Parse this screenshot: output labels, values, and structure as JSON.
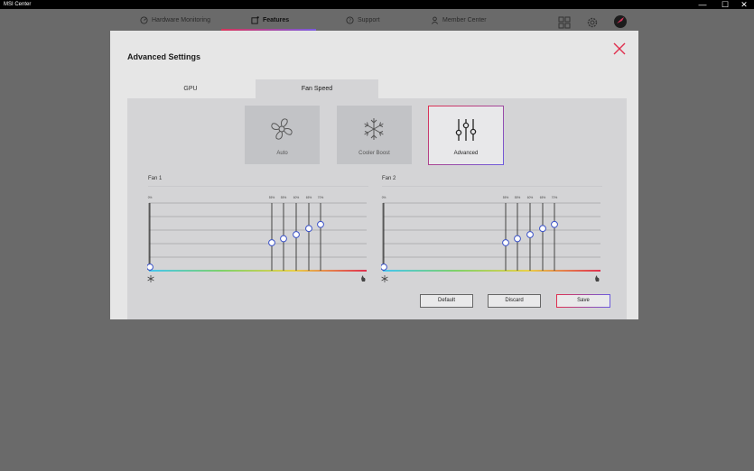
{
  "app": {
    "title": "MSI Center"
  },
  "window_controls": {
    "minimize": "—",
    "maximize": "☐",
    "close": "✕"
  },
  "nav": {
    "items": [
      {
        "label": "Hardware Monitoring",
        "icon": "gauge-icon",
        "active": false
      },
      {
        "label": "Features",
        "icon": "features-icon",
        "active": true
      },
      {
        "label": "Support",
        "icon": "support-icon",
        "active": false
      },
      {
        "label": "Member Center",
        "icon": "member-icon",
        "active": false
      }
    ],
    "right_icons": [
      "grid-icon",
      "gear-icon",
      "avatar-icon"
    ],
    "accent_gradient": [
      "#d9345b",
      "#7b5be0"
    ]
  },
  "modal": {
    "title": "Advanced Settings",
    "tabs": [
      {
        "label": "GPU",
        "selected": false
      },
      {
        "label": "Fan Speed",
        "selected": true
      }
    ],
    "modes": [
      {
        "label": "Auto",
        "icon": "fan-icon",
        "selected": false
      },
      {
        "label": "Cooler Boost",
        "icon": "snowflake-icon",
        "selected": false
      },
      {
        "label": "Advanced",
        "icon": "sliders-icon",
        "selected": true
      }
    ],
    "buttons": {
      "default": "Default",
      "discard": "Discard",
      "save": "Save"
    }
  },
  "fans": [
    {
      "label": "Fan 1",
      "tick_labels": [
        "0%",
        "55%",
        "55%",
        "60%",
        "65%",
        "70%"
      ],
      "levels": [
        0,
        0.36,
        0.42,
        0.48,
        0.57,
        0.63
      ]
    },
    {
      "label": "Fan 2",
      "tick_labels": [
        "0%",
        "55%",
        "55%",
        "60%",
        "65%",
        "70%"
      ],
      "levels": [
        0,
        0.36,
        0.42,
        0.48,
        0.57,
        0.63
      ]
    }
  ],
  "colors": {
    "accent_red": "#e0304f",
    "accent_purple": "#6c5be0",
    "temp_gradient": [
      "#45c6f0",
      "#7fd16a",
      "#e8d04a",
      "#e0304f"
    ]
  }
}
